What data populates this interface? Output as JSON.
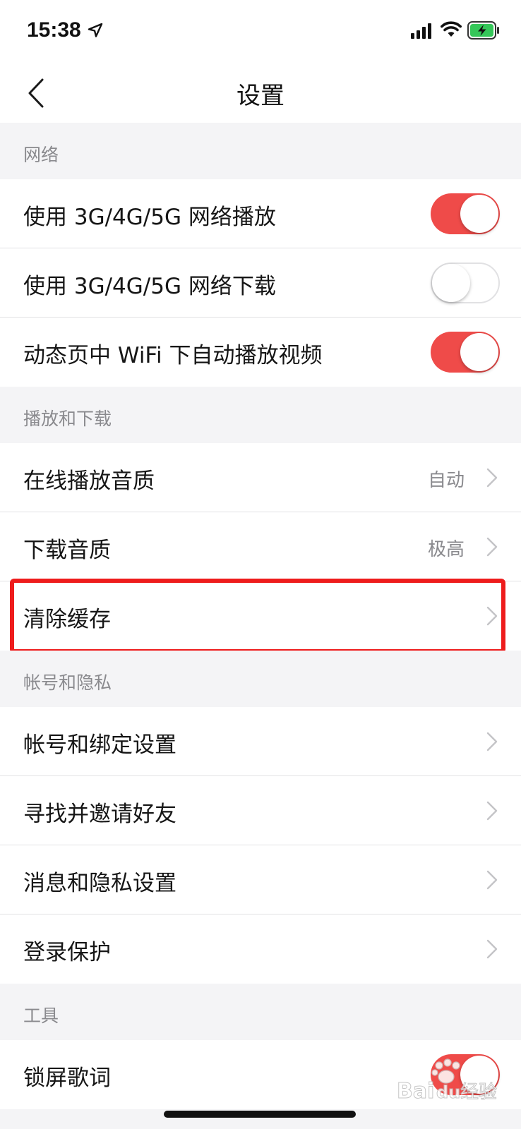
{
  "status_bar": {
    "time": "15:38",
    "icons": [
      "location-arrow-icon",
      "cellular-signal-icon",
      "wifi-icon",
      "battery-charging-icon"
    ]
  },
  "nav": {
    "title": "设置",
    "back_icon": "chevron-left-icon"
  },
  "sections": [
    {
      "header": "网络",
      "rows": [
        {
          "label": "使用 3G/4G/5G 网络播放",
          "control": "toggle",
          "on": true
        },
        {
          "label": "使用 3G/4G/5G 网络下载",
          "control": "toggle",
          "on": false
        },
        {
          "label": "动态页中 WiFi 下自动播放视频",
          "control": "toggle",
          "on": true
        }
      ]
    },
    {
      "header": "播放和下载",
      "rows": [
        {
          "label": "在线播放音质",
          "control": "link",
          "value": "自动"
        },
        {
          "label": "下载音质",
          "control": "link",
          "value": "极高"
        },
        {
          "label": "清除缓存",
          "control": "link",
          "highlighted": true
        }
      ]
    },
    {
      "header": "帐号和隐私",
      "rows": [
        {
          "label": "帐号和绑定设置",
          "control": "link"
        },
        {
          "label": "寻找并邀请好友",
          "control": "link"
        },
        {
          "label": "消息和隐私设置",
          "control": "link"
        },
        {
          "label": "登录保护",
          "control": "link"
        }
      ]
    },
    {
      "header": "工具",
      "rows": [
        {
          "label": "锁屏歌词",
          "control": "toggle",
          "on": true
        }
      ]
    }
  ],
  "colors": {
    "accent": "#ef4b49",
    "highlight": "#ee1c1c",
    "background": "#f4f4f6",
    "secondary_text": "#8a8a8e"
  },
  "watermark": "Baidu 经验"
}
